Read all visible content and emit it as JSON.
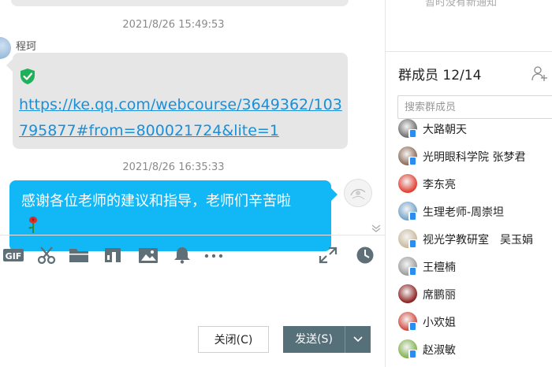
{
  "chat": {
    "timestamp1": "2021/8/26 15:49:53",
    "sender1": "程珂",
    "link_text": "https://ke.qq.com/webcourse/3649362/103795877#from=800021724&lite=1",
    "timestamp2": "2021/8/26 16:35:33",
    "message2": "感谢各位老师的建议和指导，老师们辛苦啦"
  },
  "toolbar": {
    "icons": [
      "gif-icon",
      "scissors-icon",
      "folder-icon",
      "music-icon",
      "image-icon",
      "bell-icon",
      "more-icon",
      "expand-icon",
      "clock-icon"
    ],
    "gif_label": "GIF"
  },
  "actions": {
    "close_label": "关闭(C)",
    "send_label": "发送(S)"
  },
  "side": {
    "notice": "暂时没有新通知",
    "members_title": "群成员 12/14",
    "search_placeholder": "搜索群成员",
    "members": [
      {
        "name": "大路朝天",
        "color": "#6b6b6b",
        "badge": true
      },
      {
        "name": "光明眼科学院 张梦君",
        "color": "#8b6a55",
        "badge": true
      },
      {
        "name": "李东亮",
        "color": "#e23b2e",
        "badge": false
      },
      {
        "name": "生理老师-周崇坦",
        "color": "#6fa0c8",
        "badge": true
      },
      {
        "name": "视光学教研室　吴玉娟",
        "color": "#c9b99a",
        "badge": true
      },
      {
        "name": "王檀楠",
        "color": "#9a9a9a",
        "badge": true
      },
      {
        "name": "席鹏丽",
        "color": "#8c1f1f",
        "badge": false
      },
      {
        "name": "小欢姐",
        "color": "#d2463a",
        "badge": true
      },
      {
        "name": "赵淑敏",
        "color": "#7fb24a",
        "badge": true
      }
    ]
  },
  "colors": {
    "bubble_blue": "#12b7f5",
    "bubble_grey": "#e6e6e6",
    "link": "#1a8fd8",
    "send_button": "#56707a"
  }
}
